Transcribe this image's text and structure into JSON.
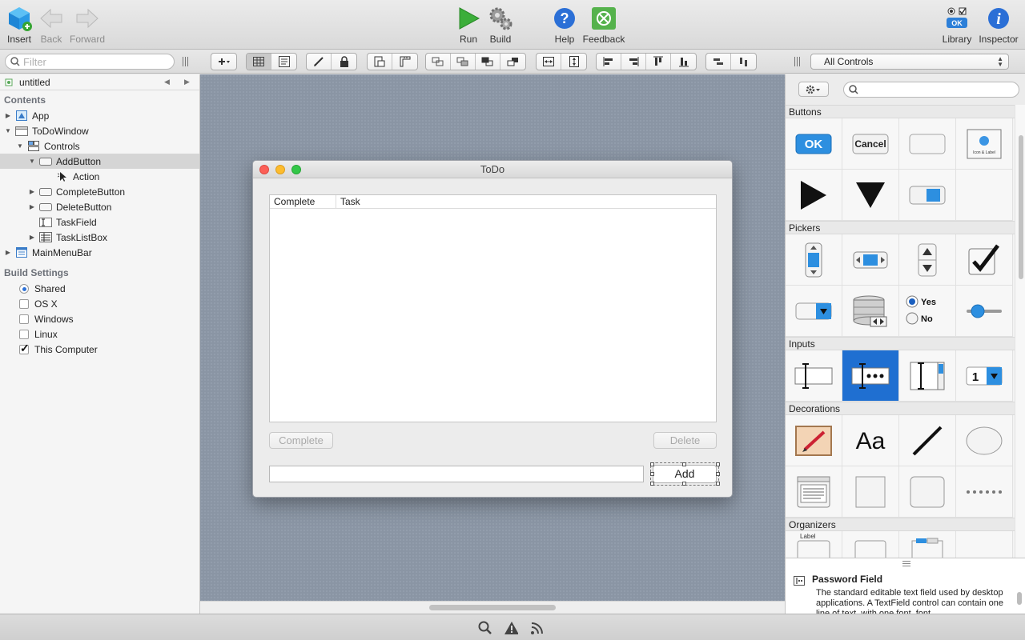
{
  "toolbar": {
    "insert": "Insert",
    "back": "Back",
    "forward": "Forward",
    "run": "Run",
    "build": "Build",
    "help": "Help",
    "feedback": "Feedback",
    "library": "Library",
    "inspector": "Inspector",
    "library_ok": "OK"
  },
  "toolbar2": {
    "filter_placeholder": "Filter",
    "controls_select": "All Controls"
  },
  "navigator": {
    "project": "untitled",
    "contents_title": "Contents",
    "items": [
      {
        "label": "App"
      },
      {
        "label": "ToDoWindow"
      },
      {
        "label": "Controls"
      },
      {
        "label": "AddButton"
      },
      {
        "label": "Action"
      },
      {
        "label": "CompleteButton"
      },
      {
        "label": "DeleteButton"
      },
      {
        "label": "TaskField"
      },
      {
        "label": "TaskListBox"
      },
      {
        "label": "MainMenuBar"
      }
    ],
    "build_settings_title": "Build Settings",
    "build_settings": [
      {
        "label": "Shared",
        "kind": "radio",
        "checked": true
      },
      {
        "label": "OS X",
        "kind": "checkbox",
        "checked": false
      },
      {
        "label": "Windows",
        "kind": "checkbox",
        "checked": false
      },
      {
        "label": "Linux",
        "kind": "checkbox",
        "checked": false
      },
      {
        "label": "This Computer",
        "kind": "checkbox",
        "checked": true
      }
    ]
  },
  "design_window": {
    "title": "ToDo",
    "columns": [
      "Complete",
      "Task"
    ],
    "complete_button": "Complete",
    "delete_button": "Delete",
    "add_button": "Add",
    "task_field_value": ""
  },
  "library": {
    "search_placeholder": "",
    "categories": [
      "Buttons",
      "Pickers",
      "Inputs",
      "Decorations",
      "Organizers"
    ],
    "ok_label": "OK",
    "cancel_label": "Cancel",
    "icon_label_text": "Icon & Label",
    "yes_label": "Yes",
    "no_label": "No",
    "popup_number": "1",
    "aa_label": "Aa",
    "label_text": "Label",
    "selected_item": "Password Field",
    "description_title": "Password Field",
    "description_text": "The standard editable text field used by desktop applications. A TextField control can contain one line of text, with one font, font"
  },
  "colors": {
    "accent": "#1f6fd1",
    "canvas": "#8a95a4",
    "run_green": "#3cae3a",
    "help_blue": "#2b6fd6"
  },
  "status_icons": [
    "search-icon",
    "warning-icon",
    "feed-icon"
  ]
}
